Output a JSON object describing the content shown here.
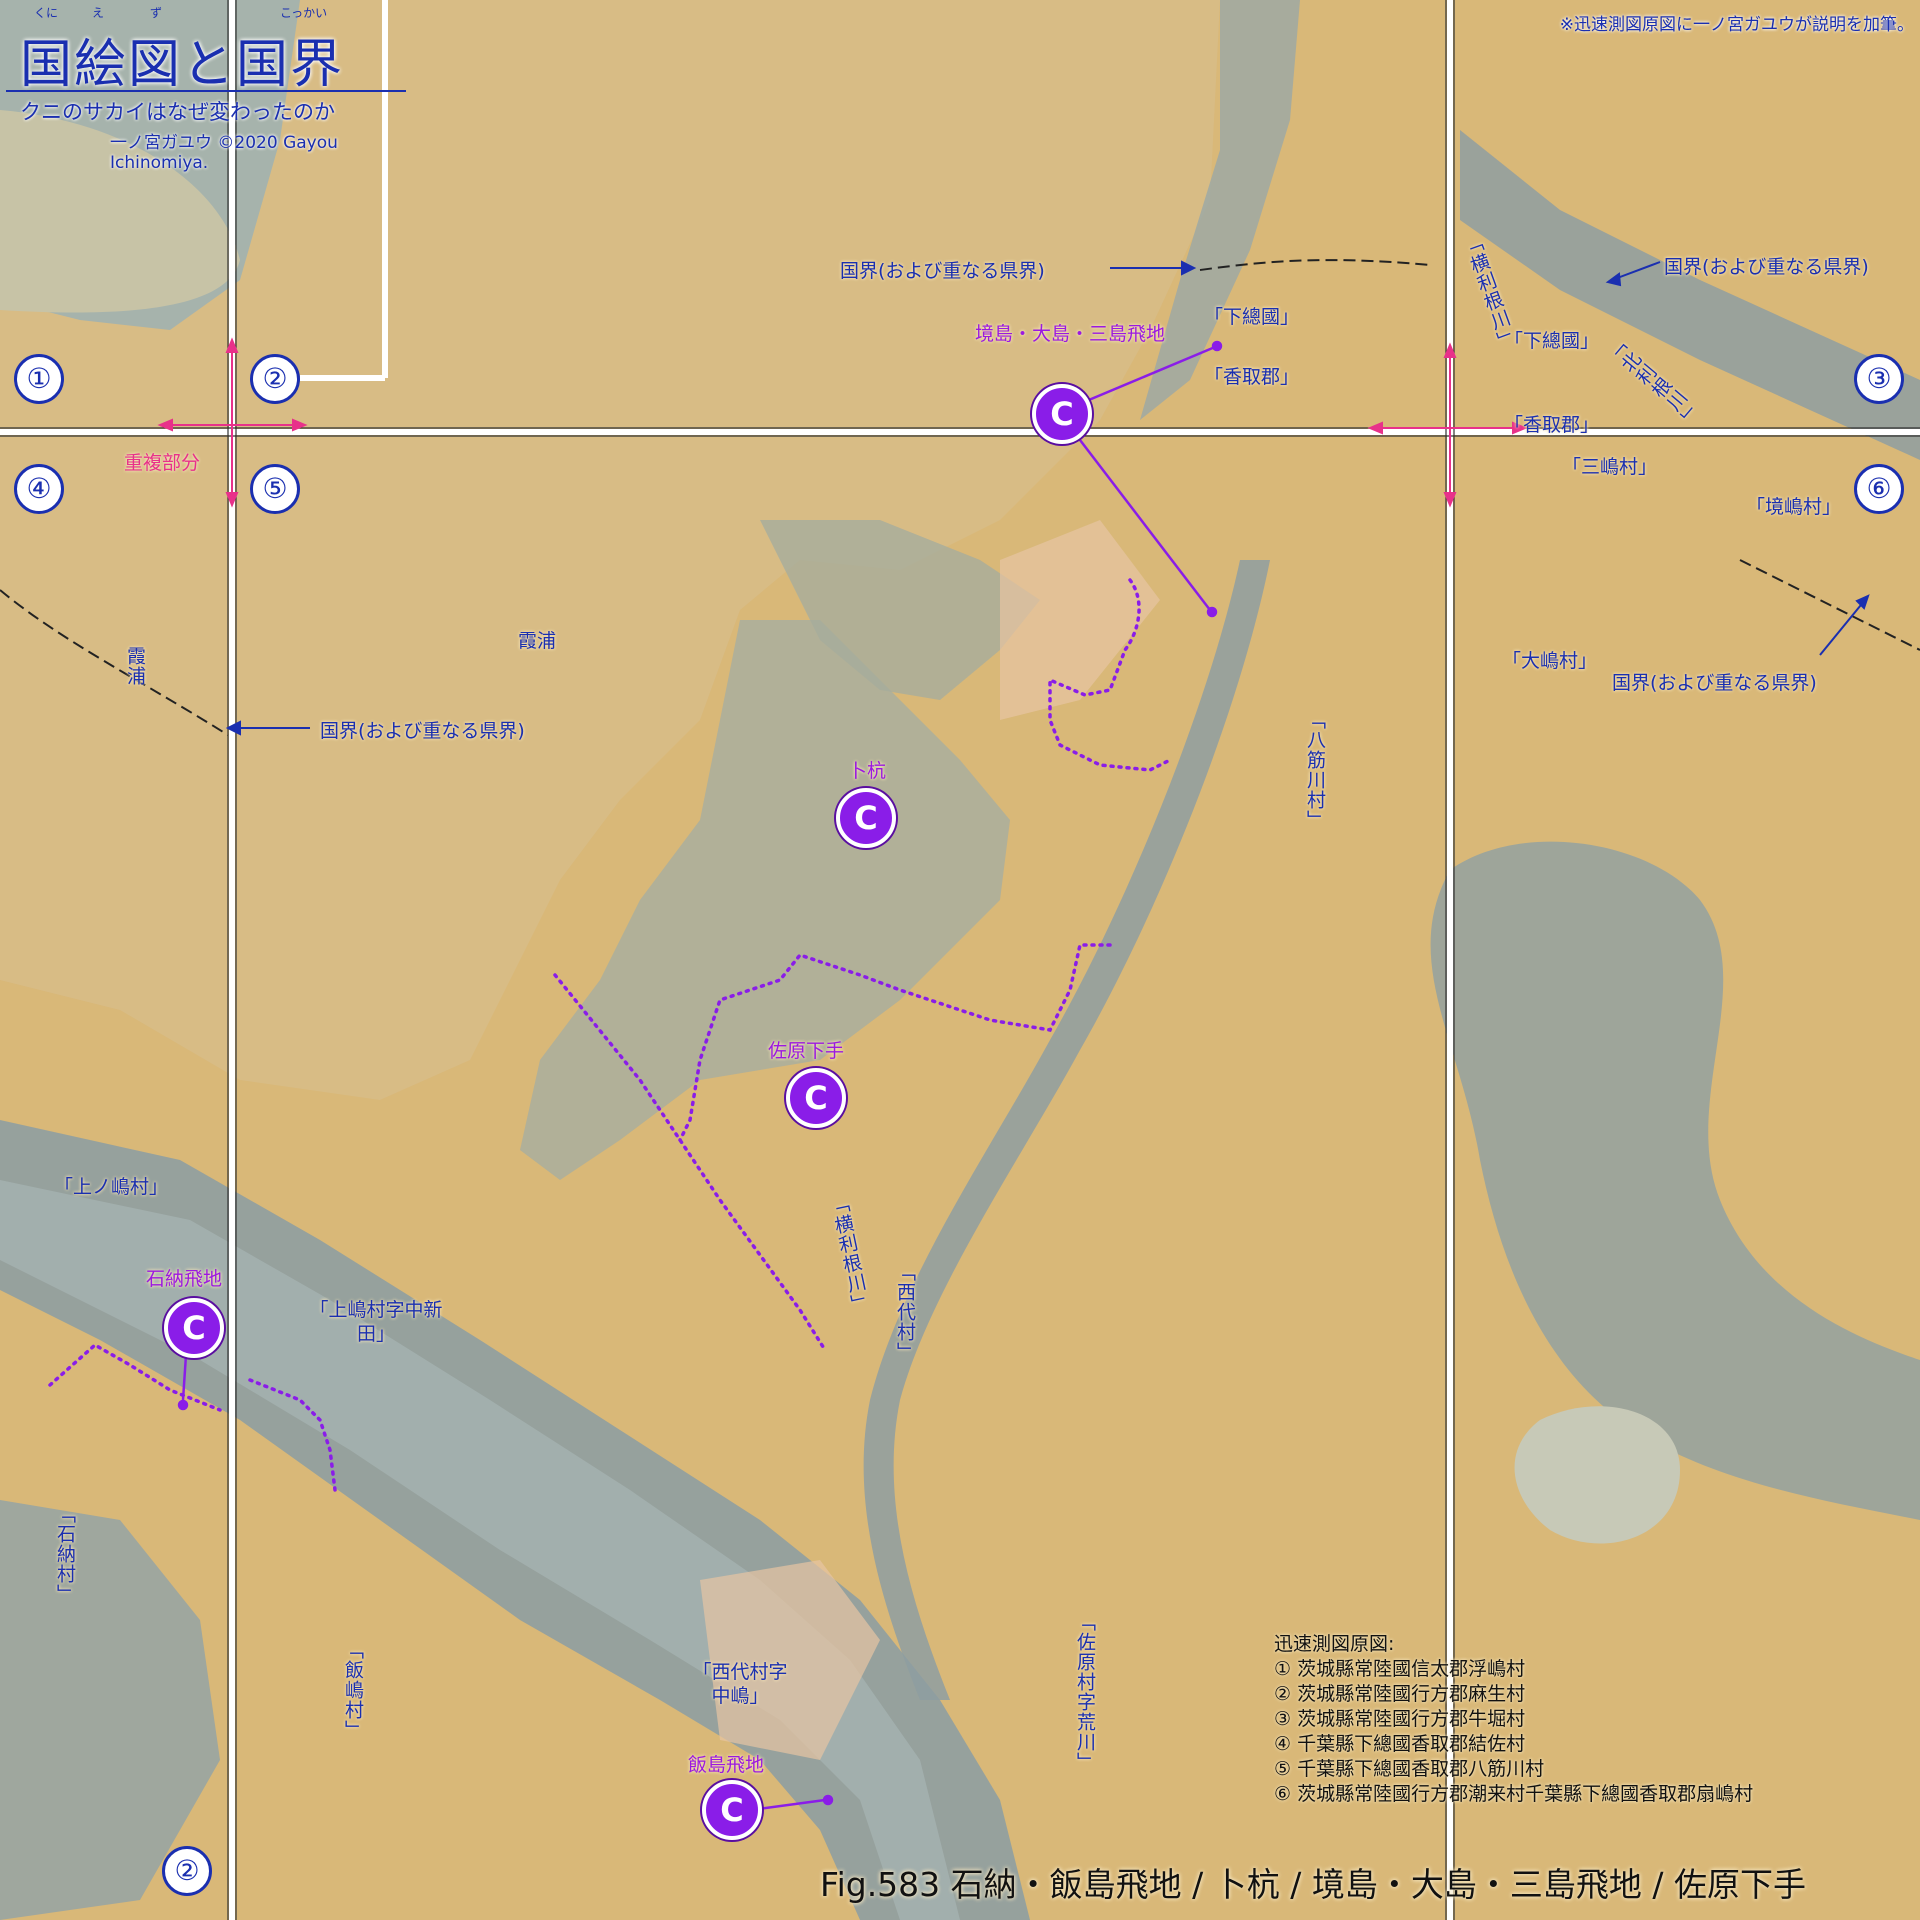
{
  "title": {
    "main": "国絵図と国界",
    "ruby_kuni": "くに",
    "ruby_e": "え",
    "ruby_zu": "ず",
    "ruby_kokkai": "こっかい",
    "subtitle": "クニのサカイはなぜ変わったのか",
    "author": "一ノ宮ガユウ ©2020 Gayou Ichinomiya."
  },
  "note": "※迅速測図原図に一ノ宮ガユウが説明を加筆。",
  "sheet_numbers": [
    "①",
    "②",
    "③",
    "④",
    "⑤",
    "⑥",
    "②"
  ],
  "labels": {
    "overlap": "重複部分",
    "border_top": "国界(および重なる県界)",
    "border_left": "国界(および重なる県界)",
    "border_right_top": "国界(および重なる県界)",
    "border_right_bottom": "国界(および重なる県界)",
    "shimousa_1": "「下總國」",
    "katori_1": "「香取郡」",
    "shimousa_2": "「下總國」",
    "katori_2": "「香取郡」",
    "tonegawa_1": "「横利根川」",
    "kitatonegawa": "「北利根川」",
    "mishima": "「三嶋村」",
    "sakaijima": "「境嶋村」",
    "oshima": "「大嶋村」",
    "yasujikawa": "「八筋川村」",
    "kasumigaura_1": "霞浦",
    "kasumigaura_2": "霞浦",
    "kaminoshima": "「上ノ嶋村」",
    "kamishima_nakashinden": "「上嶋村字中新田」",
    "ishinomura": "「石納村」",
    "iijima": "「飯嶋村」",
    "nishidai": "「西代村」",
    "tonegawa_2": "「横利根川」",
    "nishidai_nakajima": "「西代村字中嶋」",
    "sawara_arakawa": "「佐原村字荒川」"
  },
  "enclaves": [
    {
      "name": "境島・大島・三島飛地",
      "mark": "C"
    },
    {
      "name": "卜杭",
      "mark": "C"
    },
    {
      "name": "佐原下手",
      "mark": "C"
    },
    {
      "name": "石納飛地",
      "mark": "C"
    },
    {
      "name": "飯島飛地",
      "mark": "C"
    }
  ],
  "legend": {
    "heading": "迅速測図原図:",
    "items": [
      "① 茨城縣常陸國信太郡浮嶋村",
      "② 茨城縣常陸國行方郡麻生村",
      "③ 茨城縣常陸國行方郡牛堀村",
      "④ 千葉縣下總國香取郡結佐村",
      "⑤ 千葉縣下總國香取郡八筋川村",
      "⑥ 茨城縣常陸國行方郡潮来村千葉縣下總國香取郡扇嶋村"
    ]
  },
  "caption": "Fig.583 石納・飯島飛地 / 卜杭 / 境島・大島・三島飛地 / 佐原下手",
  "colors": {
    "land": "#d9b878",
    "water": "#c9c6b2",
    "marsh": "#9aa8a6",
    "label_blue": "#1a2fb0",
    "enclave_purple": "#8a1de8",
    "overlap_red": "#e8318a"
  }
}
